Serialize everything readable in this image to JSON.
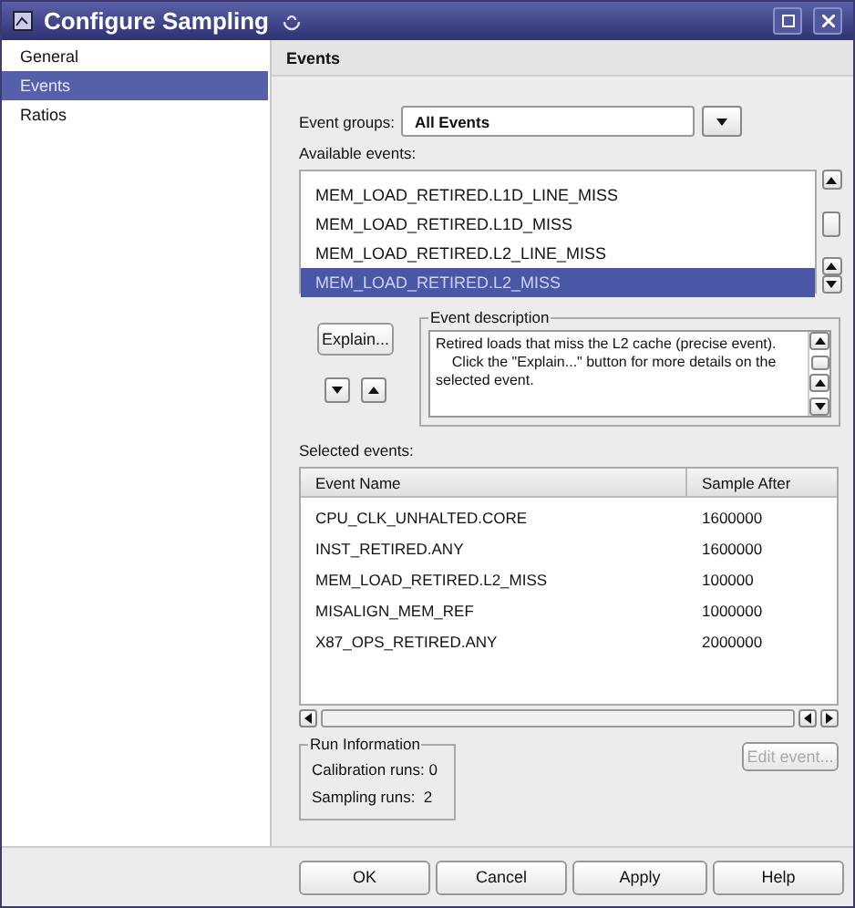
{
  "window": {
    "title": "Configure Sampling"
  },
  "sidebar": {
    "items": [
      {
        "label": "General",
        "selected": false
      },
      {
        "label": "Events",
        "selected": true
      },
      {
        "label": "Ratios",
        "selected": false
      }
    ]
  },
  "panel": {
    "title": "Events"
  },
  "event_groups": {
    "label": "Event groups:",
    "value": "All Events"
  },
  "available_events": {
    "label": "Available events:",
    "items": [
      {
        "label": "MEM_LOAD_RETIRED.L1D_LINE_MISS",
        "selected": false
      },
      {
        "label": "MEM_LOAD_RETIRED.L1D_MISS",
        "selected": false
      },
      {
        "label": "MEM_LOAD_RETIRED.L2_LINE_MISS",
        "selected": false
      },
      {
        "label": "MEM_LOAD_RETIRED.L2_MISS",
        "selected": true
      }
    ]
  },
  "explain_button": "Explain...",
  "event_description": {
    "legend": "Event description",
    "text": "Retired loads that miss the L2 cache (precise event).\n    Click the \"Explain...\" button for more details on the selected event."
  },
  "selected_events": {
    "label": "Selected events:",
    "columns": [
      "Event Name",
      "Sample After"
    ],
    "rows": [
      [
        "CPU_CLK_UNHALTED.CORE",
        "1600000"
      ],
      [
        "INST_RETIRED.ANY",
        "1600000"
      ],
      [
        "MEM_LOAD_RETIRED.L2_MISS",
        "100000"
      ],
      [
        "MISALIGN_MEM_REF",
        "1000000"
      ],
      [
        "X87_OPS_RETIRED.ANY",
        "2000000"
      ]
    ]
  },
  "edit_event_button": {
    "label": "Edit event...",
    "disabled": true
  },
  "run_information": {
    "legend": "Run Information",
    "lines": [
      "Calibration runs: 0",
      "Sampling runs:  2"
    ]
  },
  "buttons": [
    "OK",
    "Cancel",
    "Apply",
    "Help"
  ]
}
